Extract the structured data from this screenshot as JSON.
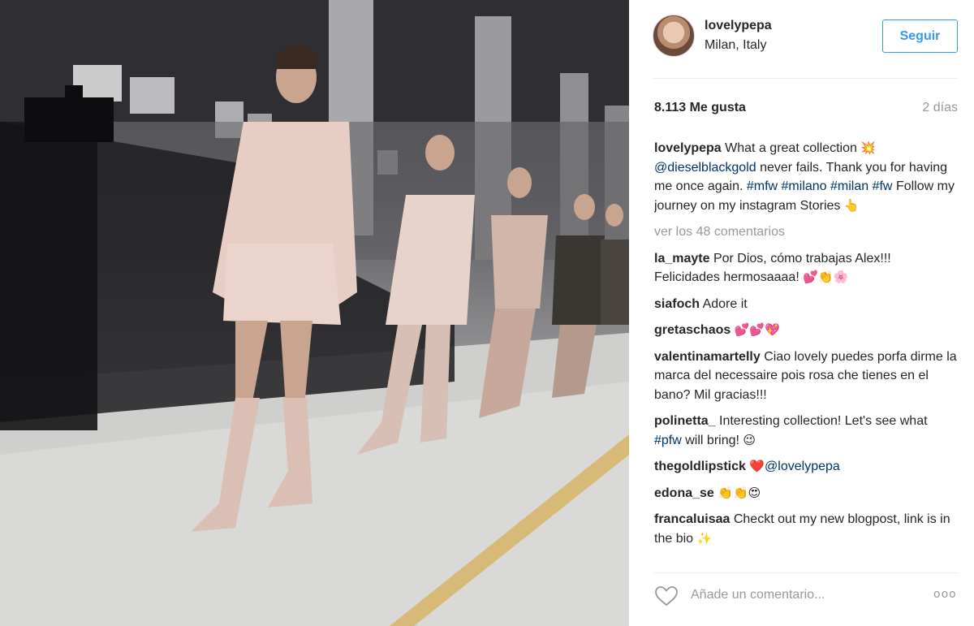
{
  "post": {
    "username": "lovelypepa",
    "location": "Milan, Italy",
    "follow_label": "Seguir",
    "likes": "8.113 Me gusta",
    "time_ago": "2 días",
    "view_all_comments": "ver los 48 comentarios"
  },
  "caption": {
    "user": "lovelypepa",
    "text_1": "What a great collection",
    "emoji_1": "💥",
    "mention": "@dieselblackgold",
    "text_2": "never fails. Thank you for having me once again.",
    "hashtags_1": "#mfw #milano #milan #fw",
    "text_3": "Follow my journey on my instagram Stories",
    "emoji_2": "👆"
  },
  "comments": [
    {
      "user": "la_mayte",
      "text": "Por Dios, cómo trabajas Alex!!! Felicidades hermosaaaa!",
      "emoji": "💕👏🌸"
    },
    {
      "user": "siafoch",
      "text": "Adore it",
      "emoji": ""
    },
    {
      "user": "gretaschaos",
      "text": "",
      "emoji": "💕💕💖"
    },
    {
      "user": "valentinamartelly",
      "text": "Ciao lovely puedes porfa dirme la marca del necessaire pois rosa che tienes en el bano? Mil gracias!!!",
      "emoji": ""
    },
    {
      "user": "polinetta_",
      "text_a": "Interesting collection! Let's see what",
      "tag": "#pfw",
      "text_b": "will bring!",
      "emoji": "😉"
    },
    {
      "user": "thegoldlipstick",
      "emoji": "❤️",
      "tag": "@lovelypepa"
    },
    {
      "user": "edona_se",
      "text": "",
      "emoji": "👏👏😍"
    },
    {
      "user": "francaluisaa",
      "text": "Checkt out my new blogpost, link is in the bio",
      "emoji": "✨"
    }
  ],
  "footer": {
    "comment_placeholder": "Añade un comentario...",
    "more_label": "ooo"
  },
  "colors": {
    "accent": "#3897f0",
    "link": "#003569",
    "muted": "#999999",
    "text": "#262626"
  },
  "icons": {
    "heart": "heart-outline-icon",
    "more": "more-options-icon",
    "avatar": "profile-avatar"
  }
}
